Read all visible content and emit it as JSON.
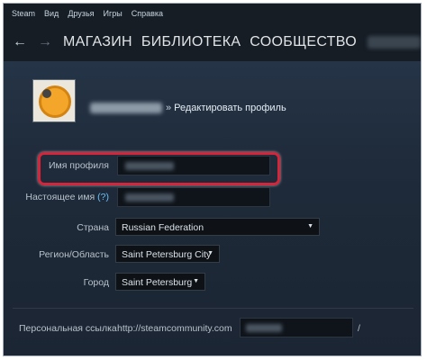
{
  "menu": [
    "Steam",
    "Вид",
    "Друзья",
    "Игры",
    "Справка"
  ],
  "nav": {
    "back_icon": "←",
    "forward_icon": "→",
    "links": [
      "МАГАЗИН",
      "БИБЛИОТЕКА",
      "СООБЩЕСТВО"
    ]
  },
  "header": {
    "separator": "»",
    "title": "Редактировать профиль"
  },
  "form": {
    "profile_name_label": "Имя профиля",
    "real_name_label": "Настоящее имя",
    "help_mark": "(?)",
    "country_label": "Страна",
    "country_value": "Russian Federation",
    "region_label": "Регион/Область",
    "region_value": "Saint Petersburg City",
    "city_label": "Город",
    "city_value": "Saint Petersburg",
    "url_label": "Персональная ссылка",
    "url_prefix": "http://steamcommunity.com",
    "url_suffix": "/"
  },
  "colors": {
    "highlight": "#d5253a",
    "link_help": "#67c1f5"
  }
}
